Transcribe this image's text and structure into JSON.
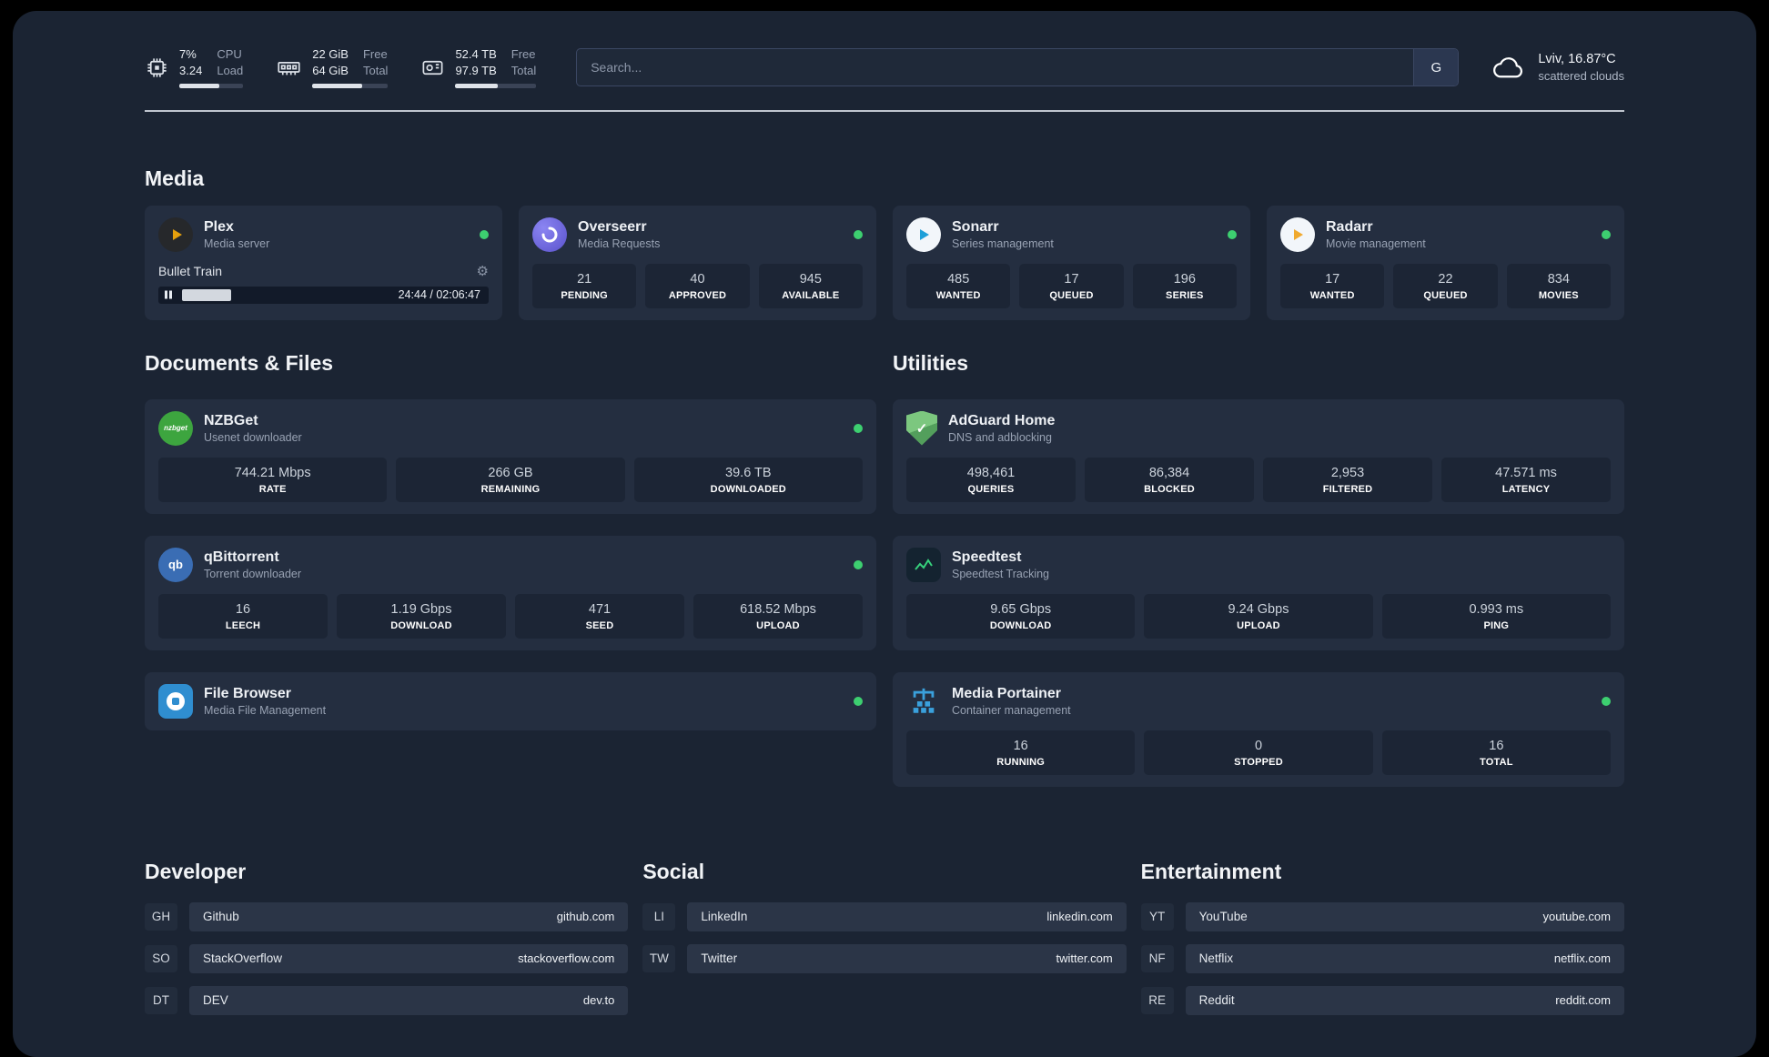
{
  "topbar": {
    "cpu": {
      "value_top": "7%",
      "value_bottom": "3.24",
      "label_top": "CPU",
      "label_bottom": "Load",
      "usage_pct": 62
    },
    "memory": {
      "value_top": "22 GiB",
      "value_bottom": "64 GiB",
      "label_top": "Free",
      "label_bottom": "Total",
      "usage_pct": 66
    },
    "disk": {
      "value_top": "52.4 TB",
      "value_bottom": "97.9 TB",
      "label_top": "Free",
      "label_bottom": "Total",
      "usage_pct": 52
    },
    "search": {
      "placeholder": "Search...",
      "engine_label": "G"
    },
    "weather": {
      "location": "Lviv, 16.87°C",
      "condition": "scattered clouds"
    }
  },
  "media": {
    "title": "Media",
    "plex": {
      "name": "Plex",
      "subtitle": "Media server",
      "status": "online",
      "now_playing": {
        "track": "Bullet Train",
        "time": "24:44 / 02:06:47",
        "progress_pct": 15,
        "gear_glyph": "⚙"
      }
    },
    "overseerr": {
      "name": "Overseerr",
      "subtitle": "Media Requests",
      "status": "online",
      "stats": [
        {
          "value": "21",
          "label": "PENDING"
        },
        {
          "value": "40",
          "label": "APPROVED"
        },
        {
          "value": "945",
          "label": "AVAILABLE"
        }
      ]
    },
    "sonarr": {
      "name": "Sonarr",
      "subtitle": "Series management",
      "status": "online",
      "stats": [
        {
          "value": "485",
          "label": "WANTED"
        },
        {
          "value": "17",
          "label": "QUEUED"
        },
        {
          "value": "196",
          "label": "SERIES"
        }
      ]
    },
    "radarr": {
      "name": "Radarr",
      "subtitle": "Movie management",
      "status": "online",
      "stats": [
        {
          "value": "17",
          "label": "WANTED"
        },
        {
          "value": "22",
          "label": "QUEUED"
        },
        {
          "value": "834",
          "label": "MOVIES"
        }
      ]
    }
  },
  "documents": {
    "title": "Documents & Files",
    "nzbget": {
      "name": "NZBGet",
      "subtitle": "Usenet downloader",
      "status": "online",
      "icon_text": "nzbget",
      "stats": [
        {
          "value": "744.21 Mbps",
          "label": "RATE"
        },
        {
          "value": "266 GB",
          "label": "REMAINING"
        },
        {
          "value": "39.6 TB",
          "label": "DOWNLOADED"
        }
      ]
    },
    "qbittorrent": {
      "name": "qBittorrent",
      "subtitle": "Torrent downloader",
      "status": "online",
      "icon_text": "qb",
      "stats": [
        {
          "value": "16",
          "label": "LEECH"
        },
        {
          "value": "1.19 Gbps",
          "label": "DOWNLOAD"
        },
        {
          "value": "471",
          "label": "SEED"
        },
        {
          "value": "618.52 Mbps",
          "label": "UPLOAD"
        }
      ]
    },
    "filebrowser": {
      "name": "File Browser",
      "subtitle": "Media File Management",
      "status": "online"
    }
  },
  "utilities": {
    "title": "Utilities",
    "adguard": {
      "name": "AdGuard Home",
      "subtitle": "DNS and adblocking",
      "status": "online",
      "icon_glyph": "✓",
      "stats": [
        {
          "value": "498,461",
          "label": "QUERIES"
        },
        {
          "value": "86,384",
          "label": "BLOCKED"
        },
        {
          "value": "2,953",
          "label": "FILTERED"
        },
        {
          "value": "47.571 ms",
          "label": "LATENCY"
        }
      ]
    },
    "speedtest": {
      "name": "Speedtest",
      "subtitle": "Speedtest Tracking",
      "status": "online",
      "stats": [
        {
          "value": "9.65 Gbps",
          "label": "DOWNLOAD"
        },
        {
          "value": "9.24 Gbps",
          "label": "UPLOAD"
        },
        {
          "value": "0.993 ms",
          "label": "PING"
        }
      ]
    },
    "portainer": {
      "name": "Media Portainer",
      "subtitle": "Container management",
      "status": "online",
      "stats": [
        {
          "value": "16",
          "label": "RUNNING"
        },
        {
          "value": "0",
          "label": "STOPPED"
        },
        {
          "value": "16",
          "label": "TOTAL"
        }
      ]
    }
  },
  "bookmarks": {
    "developer": {
      "title": "Developer",
      "links": [
        {
          "abbr": "GH",
          "name": "Github",
          "url": "github.com"
        },
        {
          "abbr": "SO",
          "name": "StackOverflow",
          "url": "stackoverflow.com"
        },
        {
          "abbr": "DT",
          "name": "DEV",
          "url": "dev.to"
        }
      ]
    },
    "social": {
      "title": "Social",
      "links": [
        {
          "abbr": "LI",
          "name": "LinkedIn",
          "url": "linkedin.com"
        },
        {
          "abbr": "TW",
          "name": "Twitter",
          "url": "twitter.com"
        }
      ]
    },
    "entertainment": {
      "title": "Entertainment",
      "links": [
        {
          "abbr": "YT",
          "name": "YouTube",
          "url": "youtube.com"
        },
        {
          "abbr": "NF",
          "name": "Netflix",
          "url": "netflix.com"
        },
        {
          "abbr": "RE",
          "name": "Reddit",
          "url": "reddit.com"
        }
      ]
    }
  },
  "colors": {
    "status_online": "#3dcf70",
    "accent_green": "#43d17a",
    "background": "#1b2433",
    "card": "#242e40"
  }
}
